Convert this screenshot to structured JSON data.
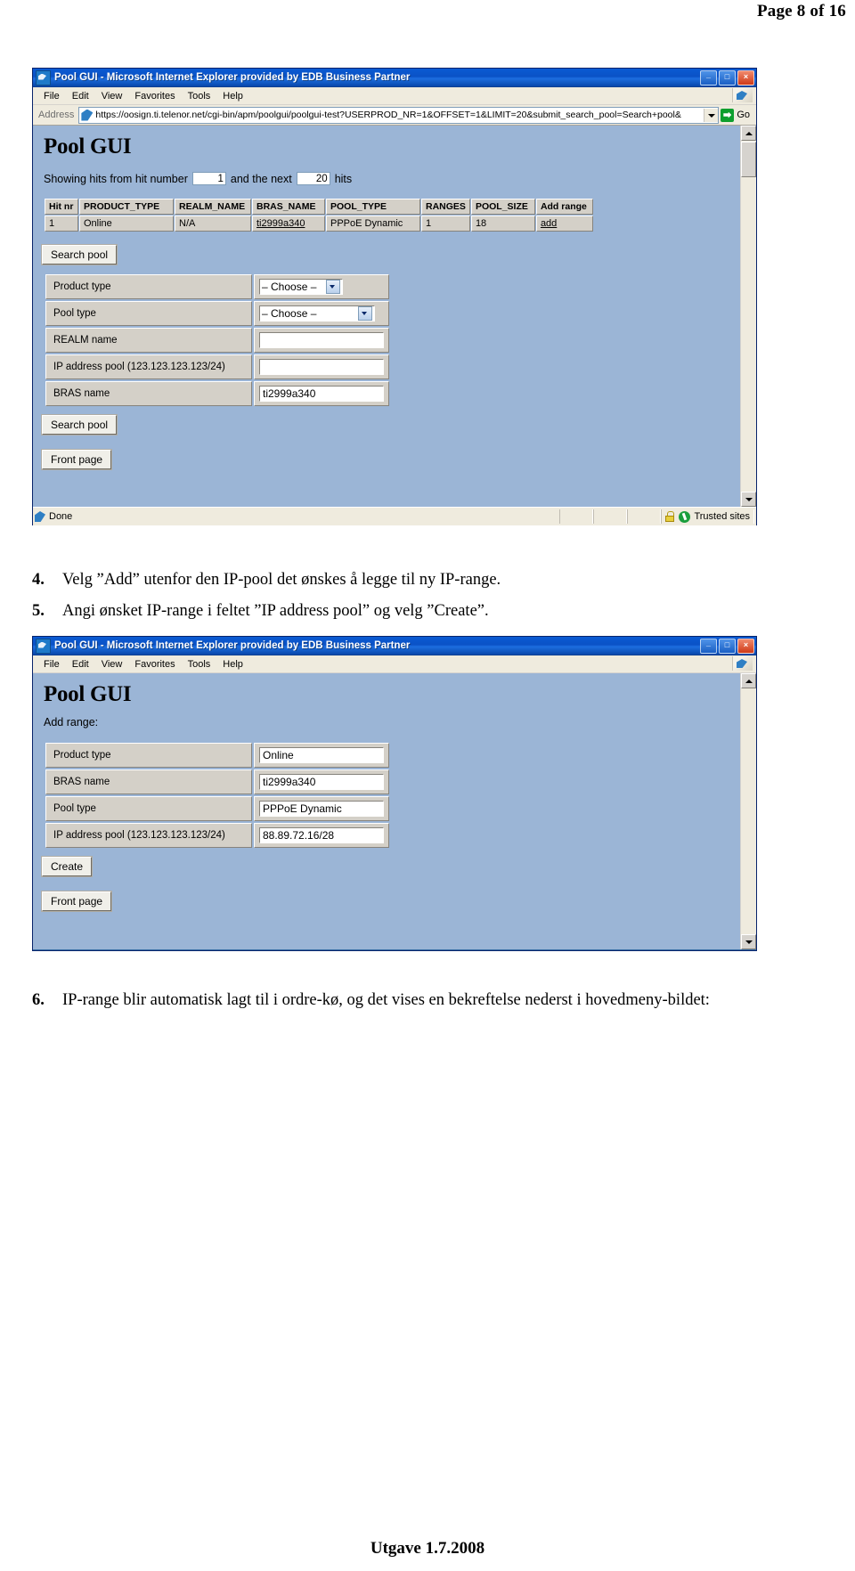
{
  "page": {
    "header": "Page 8 of 16",
    "footer": "Utgave 1.7.2008"
  },
  "window1": {
    "title": "Pool GUI - Microsoft Internet Explorer provided by EDB Business Partner",
    "title_icon": "ie-document-icon",
    "window_buttons": {
      "minimize": "_",
      "maximize": "□",
      "close": "×"
    },
    "menu": [
      "File",
      "Edit",
      "View",
      "Favorites",
      "Tools",
      "Help"
    ],
    "address": {
      "label": "Address",
      "url": "https://oosign.ti.telenor.net/cgi-bin/apm/poolgui/poolgui-test?USERPROD_NR=1&OFFSET=1&LIMIT=20&submit_search_pool=Search+pool&",
      "go_label": "Go"
    },
    "page_title": "Pool GUI",
    "hits": {
      "prefix": "Showing hits from hit number",
      "from_value": "1",
      "middle": "and the next",
      "next_value": "20",
      "suffix": "hits"
    },
    "results_table": {
      "headers": [
        "Hit nr",
        "PRODUCT_TYPE",
        "REALM_NAME",
        "BRAS_NAME",
        "POOL_TYPE",
        "RANGES",
        "POOL_SIZE",
        "Add range"
      ],
      "rows": [
        [
          "1",
          "Online",
          "N/A",
          "ti2999a340",
          "PPPoE Dynamic",
          "1",
          "18",
          "add"
        ]
      ]
    },
    "search_button_top": "Search pool",
    "search_form": {
      "rows": [
        {
          "label": "Product type",
          "type": "select",
          "value": "– Choose –",
          "width": "narrow"
        },
        {
          "label": "Pool type",
          "type": "select",
          "value": "– Choose –",
          "width": "wide"
        },
        {
          "label": "REALM name",
          "type": "text",
          "value": ""
        },
        {
          "label": "IP address pool (123.123.123.123/24)",
          "type": "text",
          "value": ""
        },
        {
          "label": "BRAS name",
          "type": "text",
          "value": "ti2999a340"
        }
      ]
    },
    "search_button_bottom": "Search pool",
    "front_page_button": "Front page",
    "statusbar": {
      "status": "Done",
      "zone": "Trusted sites",
      "lock_icon": "padlock-icon",
      "zone_icon": "trusted-sites-icon"
    }
  },
  "window2": {
    "title": "Pool GUI - Microsoft Internet Explorer provided by EDB Business Partner",
    "title_icon": "ie-document-icon",
    "window_buttons": {
      "minimize": "_",
      "maximize": "□",
      "close": "×"
    },
    "menu": [
      "File",
      "Edit",
      "View",
      "Favorites",
      "Tools",
      "Help"
    ],
    "page_title": "Pool GUI",
    "subtitle": "Add range:",
    "add_form": {
      "rows": [
        {
          "label": "Product type",
          "value": "Online"
        },
        {
          "label": "BRAS name",
          "value": "ti2999a340"
        },
        {
          "label": "Pool type",
          "value": "PPPoE Dynamic"
        },
        {
          "label": "IP address pool (123.123.123.123/24)",
          "value": "88.89.72.16/28"
        }
      ]
    },
    "create_button": "Create",
    "front_page_button": "Front page"
  },
  "instructions": [
    {
      "number": "4.",
      "text": "Velg ”Add” utenfor den IP-pool det ønskes å legge til ny IP-range."
    },
    {
      "number": "5.",
      "text": "Angi ønsket IP-range i feltet ”IP address pool” og velg ”Create”."
    },
    {
      "number": "6.",
      "text": "IP-range blir automatisk lagt til i ordre-kø, og det vises en bekreftelse nederst i hovedmeny-bildet:"
    }
  ]
}
